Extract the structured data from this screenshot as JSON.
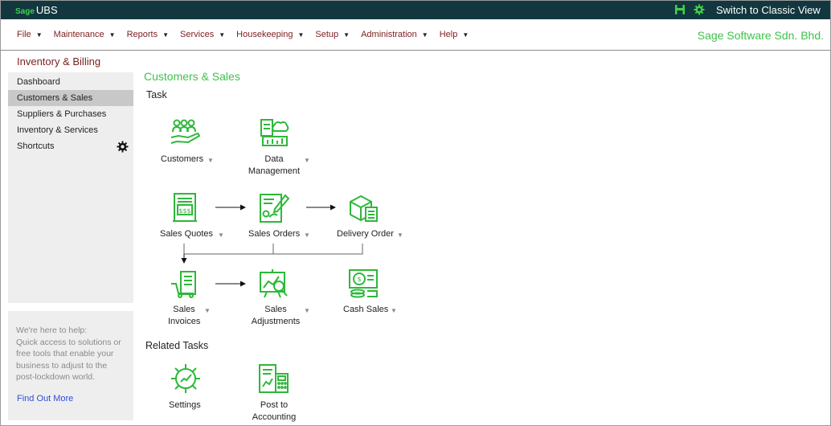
{
  "topbar": {
    "brand_prefix": "Sage",
    "brand_name": "UBS",
    "switch_label": "Switch to Classic View",
    "icons": [
      "save-icon",
      "settings-gear-icon"
    ]
  },
  "menu": {
    "items": [
      {
        "label": "File"
      },
      {
        "label": "Maintenance"
      },
      {
        "label": "Reports"
      },
      {
        "label": "Services"
      },
      {
        "label": "Housekeeping"
      },
      {
        "label": "Setup"
      },
      {
        "label": "Administration"
      },
      {
        "label": "Help"
      }
    ],
    "company": "Sage Software Sdn. Bhd."
  },
  "sidebar": {
    "title": "Inventory & Billing",
    "items": [
      {
        "label": "Dashboard"
      },
      {
        "label": "Customers & Sales"
      },
      {
        "label": "Suppliers & Purchases"
      },
      {
        "label": "Inventory & Services"
      },
      {
        "label": "Shortcuts"
      }
    ],
    "active_index": 1
  },
  "help": {
    "text": "We're here to help: Quick access to solutions or free tools that enable your business to adjust to the post-lockdown world.",
    "lines": [
      "We're here to help:",
      "Quick access to solutions or",
      "free tools that enable your",
      "business to adjust to the",
      "post-lockdown world."
    ],
    "link": "Find Out More"
  },
  "main": {
    "section_title": "Customers & Sales",
    "task_heading": "Task",
    "related_heading": "Related Tasks",
    "tasks": {
      "customers": {
        "label": "Customers"
      },
      "data_management": {
        "line1": "Data",
        "line2": "Management"
      },
      "sales_quotes": {
        "label": "Sales Quotes"
      },
      "sales_orders": {
        "label": "Sales Orders"
      },
      "delivery_order": {
        "label": "Delivery Order"
      },
      "sales_invoices": {
        "line1": "Sales",
        "line2": "Invoices"
      },
      "sales_adjustments": {
        "line1": "Sales",
        "line2": "Adjustments"
      },
      "cash_sales": {
        "label": "Cash Sales"
      }
    },
    "related": {
      "settings": {
        "label": "Settings"
      },
      "post_to_accounting": {
        "line1": "Post to",
        "line2": "Accounting"
      }
    }
  },
  "colors": {
    "topbar": "#13373f",
    "accent_green": "#3fc24a",
    "menu_text": "#7b1e1e",
    "link_blue": "#2b4fd6"
  }
}
